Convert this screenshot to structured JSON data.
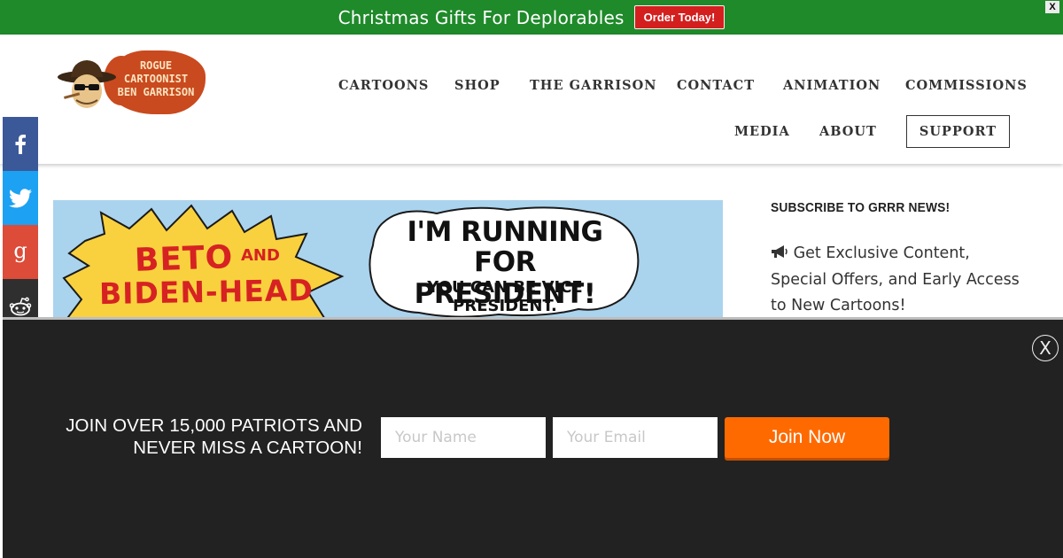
{
  "promo_banner": {
    "text": "Christmas Gifts For Deplorables",
    "button_label": "Order Today!",
    "close_label": "X",
    "background_color": "#1f8a2a",
    "button_color": "#d41f1f"
  },
  "logo": {
    "text_line1": "ROGUE",
    "text_line2": "CARTOONIST",
    "text_line3": "BEN GARRISON"
  },
  "nav": {
    "items": [
      {
        "label": "CARTOONS"
      },
      {
        "label": "SHOP"
      },
      {
        "label": "THE GARRISON"
      },
      {
        "label": "CONTACT"
      },
      {
        "label": "ANIMATION"
      },
      {
        "label": "COMMISSIONS"
      },
      {
        "label": "MEDIA"
      },
      {
        "label": "ABOUT"
      }
    ],
    "support_label": "SUPPORT"
  },
  "social": {
    "icons": [
      "facebook-icon",
      "twitter-icon",
      "google-plus-icon",
      "reddit-icon",
      "email-icon",
      "flipboard-icon"
    ],
    "google_plus_glyph": "g"
  },
  "cartoon": {
    "title_line1": "BETO",
    "title_and": "AND",
    "title_line2": "BIDEN-HEAD",
    "speech_line1": "I'M RUNNING",
    "speech_line2": "FOR PRESIDENT!",
    "speech_line3": "YOU CAN BE VICE PRESIDENT.",
    "background_color": "#aad3ee"
  },
  "sidebar": {
    "heading": "SUBSCRIBE TO GRRR NEWS!",
    "text": "Get Exclusive Content, Special Offers, and Early Access to New Cartoons!"
  },
  "popup": {
    "headline_line1": "JOIN OVER 15,000 PATRIOTS AND",
    "headline_line2": "NEVER MISS A CARTOON!",
    "name_placeholder": "Your Name",
    "email_placeholder": "Your Email",
    "join_label": "Join Now",
    "close_label": "X",
    "accent_color": "#ff6a00"
  }
}
